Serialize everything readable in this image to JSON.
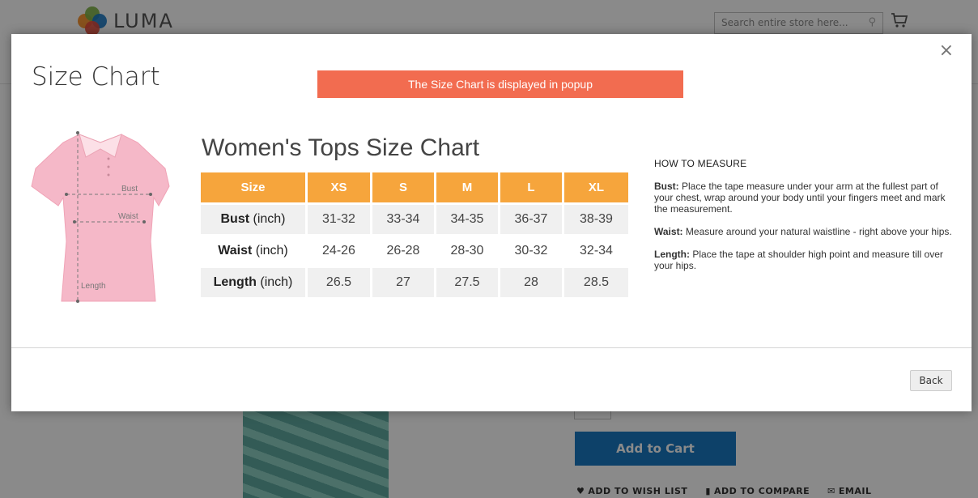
{
  "background": {
    "logo_text": "LUMA",
    "search_placeholder": "Search entire store here...",
    "add_to_cart_label": "Add to Cart",
    "actions": [
      "ADD TO WISH LIST",
      "ADD TO COMPARE",
      "EMAIL"
    ],
    "colors": {
      "primary_button": "#1979c3"
    }
  },
  "modal": {
    "title": "Size Chart",
    "banner": "The Size Chart is displayed in popup",
    "close_label": "×",
    "back_label": "Back",
    "colors": {
      "banner": "#f26c50",
      "table_header": "#f6a53c"
    },
    "illustration_labels": {
      "bust": "Bust",
      "waist": "Waist",
      "length": "Length"
    },
    "chart": {
      "title": "Women's Tops Size Chart",
      "header_first": "Size",
      "sizes": [
        "XS",
        "S",
        "M",
        "L",
        "XL"
      ],
      "rows": [
        {
          "label": "Bust",
          "unit": "(inch)",
          "values": [
            "31-32",
            "33-34",
            "34-35",
            "36-37",
            "38-39"
          ]
        },
        {
          "label": "Waist",
          "unit": "(inch)",
          "values": [
            "24-26",
            "26-28",
            "28-30",
            "30-32",
            "32-34"
          ]
        },
        {
          "label": "Length",
          "unit": "(inch)",
          "values": [
            "26.5",
            "27",
            "27.5",
            "28",
            "28.5"
          ]
        }
      ]
    },
    "how_to_measure": {
      "heading": "HOW TO MEASURE",
      "items": [
        {
          "term": "Bust:",
          "text": " Place the tape measure under your arm at the fullest part of your chest, wrap around your body until your fingers meet and mark the measurement."
        },
        {
          "term": "Waist:",
          "text": " Measure around your natural waistline - right above your hips."
        },
        {
          "term": "Length:",
          "text": " Place the tape at shoulder high point and measure till over your hips."
        }
      ]
    }
  }
}
